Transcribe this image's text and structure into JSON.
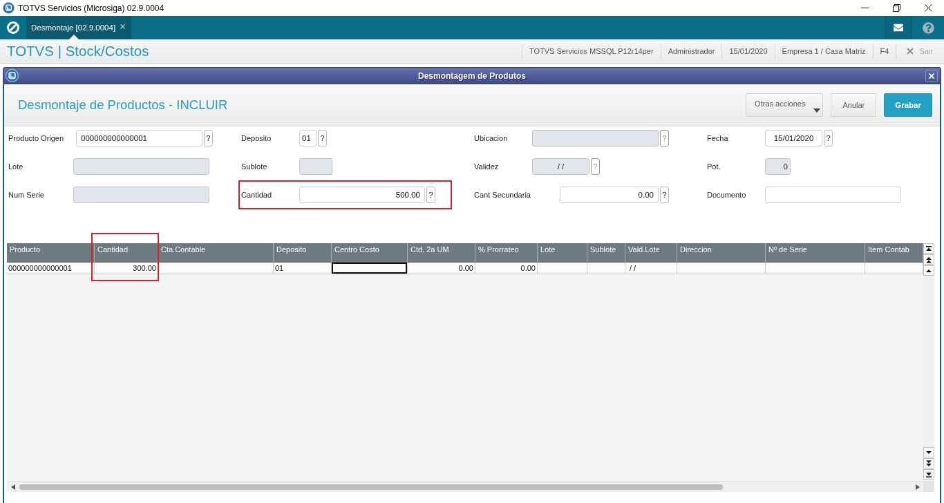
{
  "window": {
    "title": "TOTVS Servicios (Microsiga) 02.9.0004"
  },
  "app_tabs": [
    {
      "label": "Desmontaje [02.9.0004]",
      "selected": true
    }
  ],
  "app_header": {
    "title": "TOTVS | Stock/Costos",
    "session_info": [
      "TOTVS Servicios MSSQL P12r14per",
      "Administrador",
      "15/01/2020",
      "Empresa 1 / Casa Matriz",
      "F4"
    ],
    "exit_button": {
      "label": "Sair",
      "disabled": true
    }
  },
  "dialog": {
    "title": "Desmontagem de Produtos",
    "heading": "Desmontaje de Productos - INCLUIR",
    "actions": [
      {
        "label": "Otras acciones",
        "kind": "menu"
      },
      {
        "label": "Anular",
        "kind": "default"
      },
      {
        "label": "Grabar",
        "kind": "primary"
      }
    ],
    "form_rows": [
      [
        {
          "label": "Producto Origen",
          "kind": "text",
          "value": "000000000000001",
          "disabled": false,
          "highlighted": false,
          "lookup": {
            "label": "?",
            "disabled": false
          }
        },
        {
          "label": "Deposito",
          "kind": "text",
          "value": "01",
          "disabled": false,
          "highlighted": false,
          "lookup": {
            "label": "?",
            "disabled": false
          }
        },
        {
          "label": "Ubicacion",
          "kind": "text",
          "disabled": true,
          "highlighted": false,
          "lookup": {
            "label": "?",
            "disabled": true
          }
        },
        {
          "label": "Fecha",
          "kind": "date",
          "value": "15/01/2020",
          "disabled": false,
          "highlighted": false,
          "lookup": {
            "label": "?",
            "disabled": false
          }
        }
      ],
      [
        {
          "label": "Lote",
          "kind": "text",
          "disabled": true,
          "highlighted": false
        },
        {
          "label": "Sublote",
          "kind": "text",
          "disabled": true,
          "highlighted": false
        },
        {
          "label": "Validez",
          "kind": "date",
          "value": "/ /",
          "disabled": true,
          "highlighted": false,
          "lookup": {
            "label": "?",
            "disabled": true
          }
        },
        {
          "label": "Pot.",
          "kind": "number",
          "value": "0",
          "disabled": true,
          "highlighted": false
        }
      ],
      [
        {
          "label": "Num Serie",
          "kind": "text",
          "disabled": true,
          "highlighted": false
        },
        {
          "label": "Cantidad",
          "kind": "number",
          "value": "500.00",
          "disabled": false,
          "highlighted": true,
          "lookup": {
            "label": "?",
            "disabled": false
          }
        },
        {
          "label": "Cant Secundaria",
          "kind": "number",
          "value": "0.00",
          "disabled": false,
          "highlighted": false,
          "lookup": {
            "label": "?",
            "disabled": false
          }
        },
        {
          "label": "Documento",
          "kind": "text",
          "disabled": false,
          "highlighted": false
        }
      ]
    ],
    "grid": {
      "columns": [
        {
          "label": "Producto",
          "kind": "text",
          "highlighted": false
        },
        {
          "label": "Cantidad",
          "kind": "number",
          "highlighted": true
        },
        {
          "label": "Cta.Contable",
          "kind": "text",
          "highlighted": false
        },
        {
          "label": "Deposito",
          "kind": "text",
          "highlighted": false
        },
        {
          "label": "Centro Costo",
          "kind": "text",
          "highlighted": false
        },
        {
          "label": "Ctd. 2a UM",
          "kind": "number",
          "highlighted": false
        },
        {
          "label": "% Prorrateo",
          "kind": "number",
          "highlighted": false
        },
        {
          "label": "Lote",
          "kind": "text",
          "highlighted": false
        },
        {
          "label": "Sublote",
          "kind": "text",
          "highlighted": false
        },
        {
          "label": "Vald.Lote",
          "kind": "date",
          "highlighted": false
        },
        {
          "label": "Direccion",
          "kind": "text",
          "highlighted": false
        },
        {
          "label": "Nº de Serie",
          "kind": "text",
          "highlighted": false
        },
        {
          "label": "Item Contab",
          "kind": "text",
          "highlighted": false
        }
      ],
      "rows": [
        {
          "cells": [
            {
              "value": "000000000000001",
              "focused": false
            },
            {
              "value": "300.00",
              "focused": false
            },
            {
              "focused": false
            },
            {
              "value": "01",
              "focused": false
            },
            {
              "focused": true
            },
            {
              "value": "0.00",
              "focused": false
            },
            {
              "value": "0.00",
              "focused": false
            },
            {
              "focused": false
            },
            {
              "focused": false
            },
            {
              "value": "/ /",
              "focused": false
            },
            {
              "focused": false
            },
            {
              "focused": false
            },
            {
              "focused": false
            }
          ]
        }
      ]
    }
  }
}
